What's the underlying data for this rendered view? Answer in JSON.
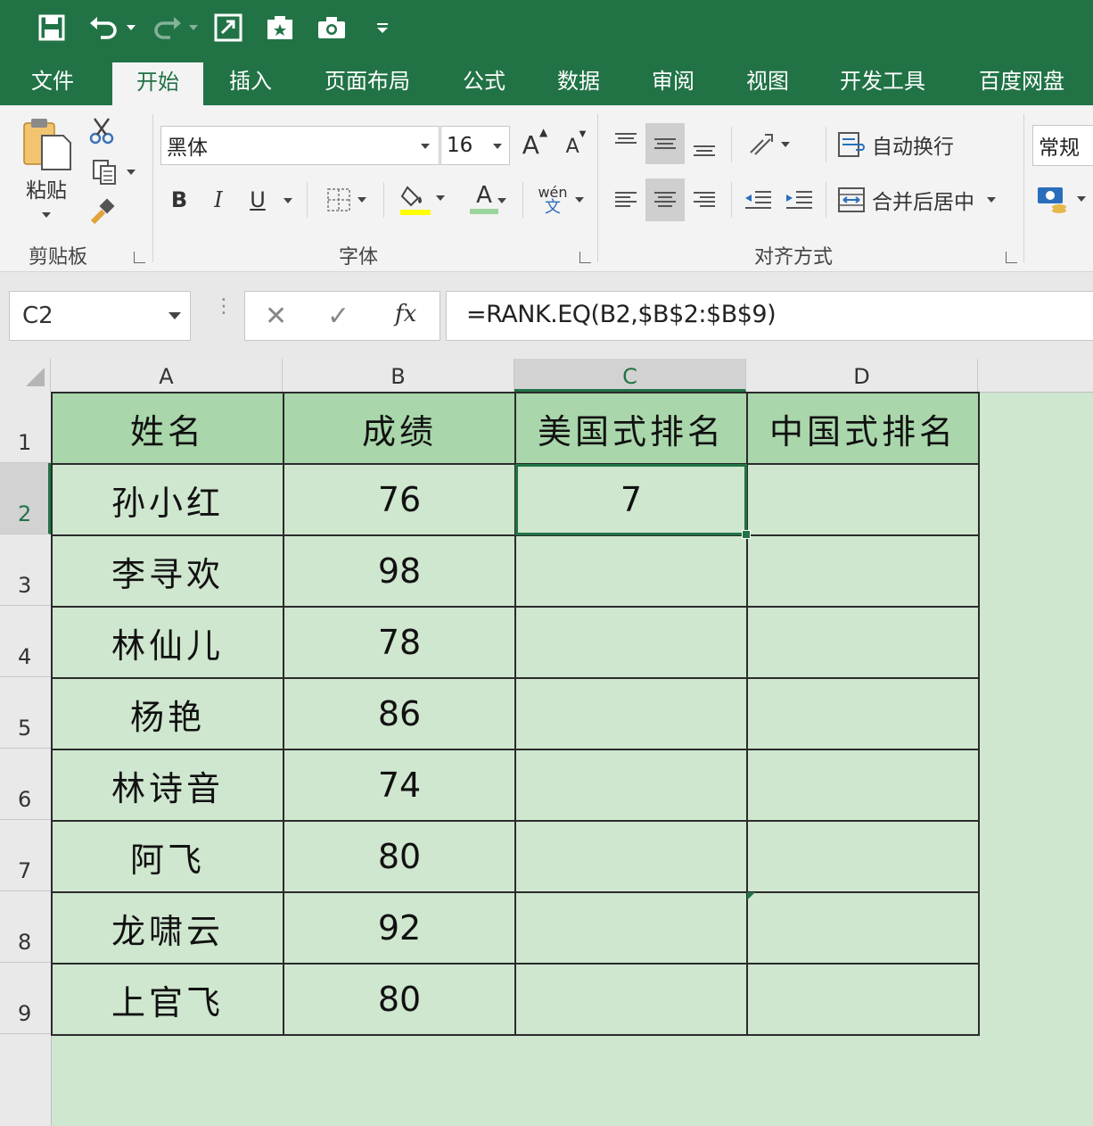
{
  "quick_access": {
    "icons": [
      "save-icon",
      "undo-icon",
      "redo-icon",
      "form-icon",
      "macro-icon",
      "camera-icon",
      "customize-icon"
    ]
  },
  "tabs": [
    {
      "label": "文件"
    },
    {
      "label": "开始"
    },
    {
      "label": "插入"
    },
    {
      "label": "页面布局"
    },
    {
      "label": "公式"
    },
    {
      "label": "数据"
    },
    {
      "label": "审阅"
    },
    {
      "label": "视图"
    },
    {
      "label": "开发工具"
    },
    {
      "label": "百度网盘"
    }
  ],
  "active_tab": "开始",
  "ribbon": {
    "clipboard": {
      "paste_label": "粘贴",
      "group_label": "剪贴板"
    },
    "font": {
      "font_name": "黑体",
      "font_size": "16",
      "group_label": "字体",
      "bold": "B",
      "italic": "I",
      "underline": "U",
      "font_color_glyph": "A",
      "grow_glyph": "A",
      "shrink_glyph": "A",
      "phonetic_top": "wén",
      "phonetic_bottom": "文"
    },
    "alignment": {
      "wrap_text_label": "自动换行",
      "merge_center_label": "合并后居中",
      "group_label": "对齐方式"
    },
    "number": {
      "format": "常规"
    }
  },
  "formula_bar": {
    "name_box": "C2",
    "fx_label": "fx",
    "formula": "=RANK.EQ(B2,$B$2:$B$9)"
  },
  "grid": {
    "columns": [
      "A",
      "B",
      "C",
      "D"
    ],
    "rows": [
      "1",
      "2",
      "3",
      "4",
      "5",
      "6",
      "7",
      "8",
      "9"
    ],
    "selected_cell": "C2",
    "header_row": [
      "姓名",
      "成绩",
      "美国式排名",
      "中国式排名"
    ],
    "data": [
      [
        "孙小红",
        "76",
        "7",
        ""
      ],
      [
        "李寻欢",
        "98",
        "",
        ""
      ],
      [
        "林仙儿",
        "78",
        "",
        ""
      ],
      [
        "杨艳",
        "86",
        "",
        ""
      ],
      [
        "林诗音",
        "74",
        "",
        ""
      ],
      [
        "阿飞",
        "80",
        "",
        ""
      ],
      [
        "龙啸云",
        "92",
        "",
        ""
      ],
      [
        "上官飞",
        "80",
        "",
        ""
      ]
    ]
  },
  "colors": {
    "accent": "#217346",
    "header_fill": "#a9d6aa",
    "cell_fill": "#cfe6cf",
    "highlight": "#ffff00"
  }
}
